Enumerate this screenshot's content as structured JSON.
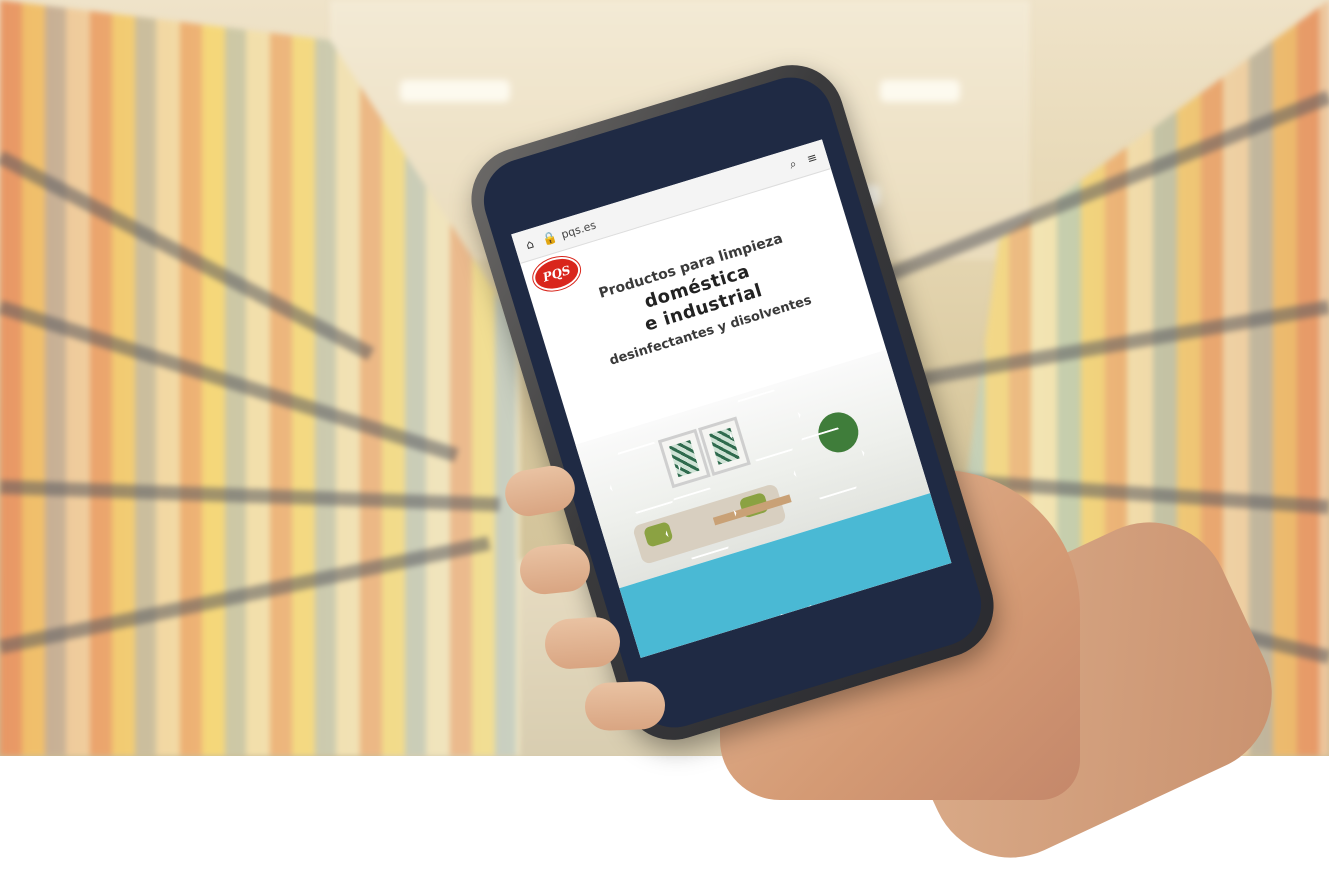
{
  "browser": {
    "url": "pqs.es",
    "lock_icon": "lock-icon",
    "home_icon": "home-icon",
    "search_icon": "search-icon",
    "menu_icon": "hamburger-menu-icon"
  },
  "site": {
    "logo_text": "PQS",
    "headline_line1": "Productos para limpieza",
    "headline_line2a": "doméstica",
    "headline_line2b": "e industrial",
    "headline_line3": "desinfectantes y disolventes"
  },
  "colors": {
    "brand_red": "#d9261c",
    "accent_teal": "#4ab9d4",
    "phone_bezel": "#1f2a44"
  }
}
